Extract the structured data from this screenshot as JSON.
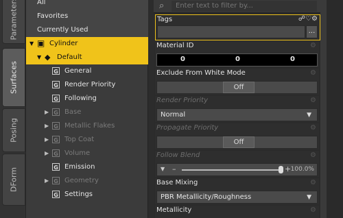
{
  "side_tabs": [
    "Parameters",
    "Surfaces",
    "Posing",
    "DForm"
  ],
  "tree": {
    "headers": [
      "All",
      "Favorites",
      "Currently Used"
    ],
    "cylinder": "Cylinder",
    "default": "Default",
    "items": [
      {
        "label": "General",
        "expandable": false,
        "dim": false
      },
      {
        "label": "Render Priority",
        "expandable": false,
        "dim": false
      },
      {
        "label": "Following",
        "expandable": false,
        "dim": false
      },
      {
        "label": "Base",
        "expandable": true,
        "dim": true
      },
      {
        "label": "Metallic Flakes",
        "expandable": true,
        "dim": true
      },
      {
        "label": "Top Coat",
        "expandable": true,
        "dim": true
      },
      {
        "label": "Volume",
        "expandable": true,
        "dim": true
      },
      {
        "label": "Emission",
        "expandable": false,
        "dim": false
      },
      {
        "label": "Geometry",
        "expandable": true,
        "dim": true
      },
      {
        "label": "Settings",
        "expandable": false,
        "dim": false
      }
    ]
  },
  "filter": {
    "placeholder": "Enter text to filter by..."
  },
  "properties": {
    "tags": {
      "label": "Tags",
      "button": "..."
    },
    "material_id": {
      "label": "Material ID",
      "values": [
        "0",
        "0",
        "0"
      ]
    },
    "exclude_white": {
      "label": "Exclude From White Mode",
      "value": "Off"
    },
    "render_priority": {
      "label": "Render Priority",
      "value": "Normal"
    },
    "propagate_priority": {
      "label": "Propagate Priority",
      "value": "Off"
    },
    "follow_blend": {
      "label": "Follow Blend",
      "value_text": "100.0%",
      "level_percent": 100
    },
    "base_mixing": {
      "label": "Base Mixing",
      "value": "PBR Metallicity/Roughness"
    },
    "metallicity": {
      "label": "Metallicity"
    }
  }
}
